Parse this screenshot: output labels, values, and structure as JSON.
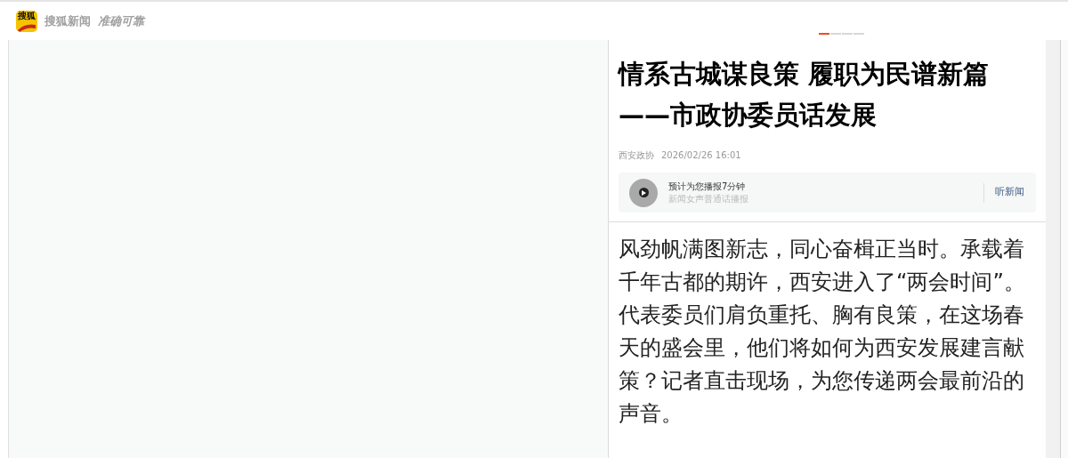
{
  "header": {
    "logo_text": "搜狐",
    "brand": "搜狐新闻",
    "slogan": "准确可靠"
  },
  "carousel_indicators": [
    {
      "selected": true
    },
    {
      "selected": false
    },
    {
      "selected": false
    },
    {
      "selected": false
    }
  ],
  "article": {
    "title_lines": [
      "情系古城谋良策 履职为民谱新篇",
      "——市政协委员话发展"
    ],
    "source": "西安政协",
    "time": "2026/02/26 16:01",
    "audio": {
      "title": "预计为您播报7分钟",
      "subtitle": "新闻女声普通话播报",
      "action": "听新闻"
    },
    "body": "风劲帆满图新志，同心奋楫正当时。承载着千年古都的期许，西安进入了“两会时间”。代表委员们肩负重托、胸有良策，在这场春天的盛会里，他们将如何为西安发展建言献策？记者直击现场，为您传递两会最前沿的声音。"
  }
}
